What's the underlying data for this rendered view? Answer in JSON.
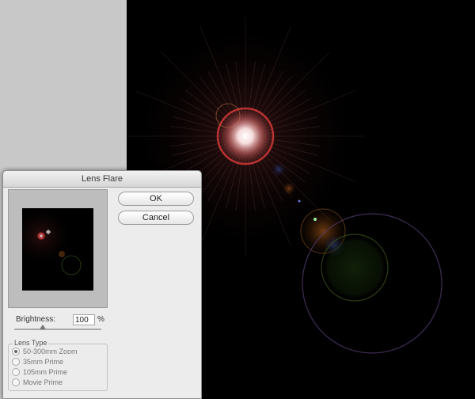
{
  "dialog": {
    "title": "Lens Flare",
    "ok_label": "OK",
    "cancel_label": "Cancel",
    "brightness": {
      "label": "Brightness:",
      "value": "100",
      "unit": "%",
      "fraction": 0.33
    },
    "lens_type": {
      "legend": "Lens Type",
      "options": [
        "50-300mm Zoom",
        "35mm Prime",
        "105mm Prime",
        "Movie Prime"
      ],
      "selected_index": 0
    }
  },
  "colors": {
    "canvas": "#000000",
    "flare_core": "#ffffff",
    "flare_ring": "#d93a3a",
    "pasteboard": "#c8c8c8"
  }
}
